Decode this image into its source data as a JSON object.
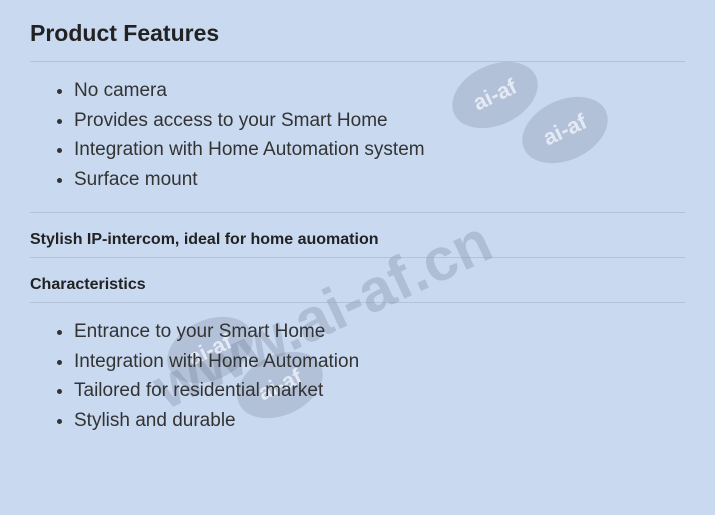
{
  "heading": "Product Features",
  "features": [
    "No camera",
    "Provides access to your Smart Home",
    "Integration with Home Automation system",
    "Surface mount"
  ],
  "subheading1": "Stylish IP-intercom, ideal for home auomation",
  "subheading2": "Characteristics",
  "characteristics": [
    "Entrance to your Smart Home",
    "Integration with Home Automation",
    "Tailored for residential market",
    "Stylish and durable"
  ],
  "watermark": {
    "url_text": "www.ai-af.cn",
    "badge_text": "ai-af"
  }
}
